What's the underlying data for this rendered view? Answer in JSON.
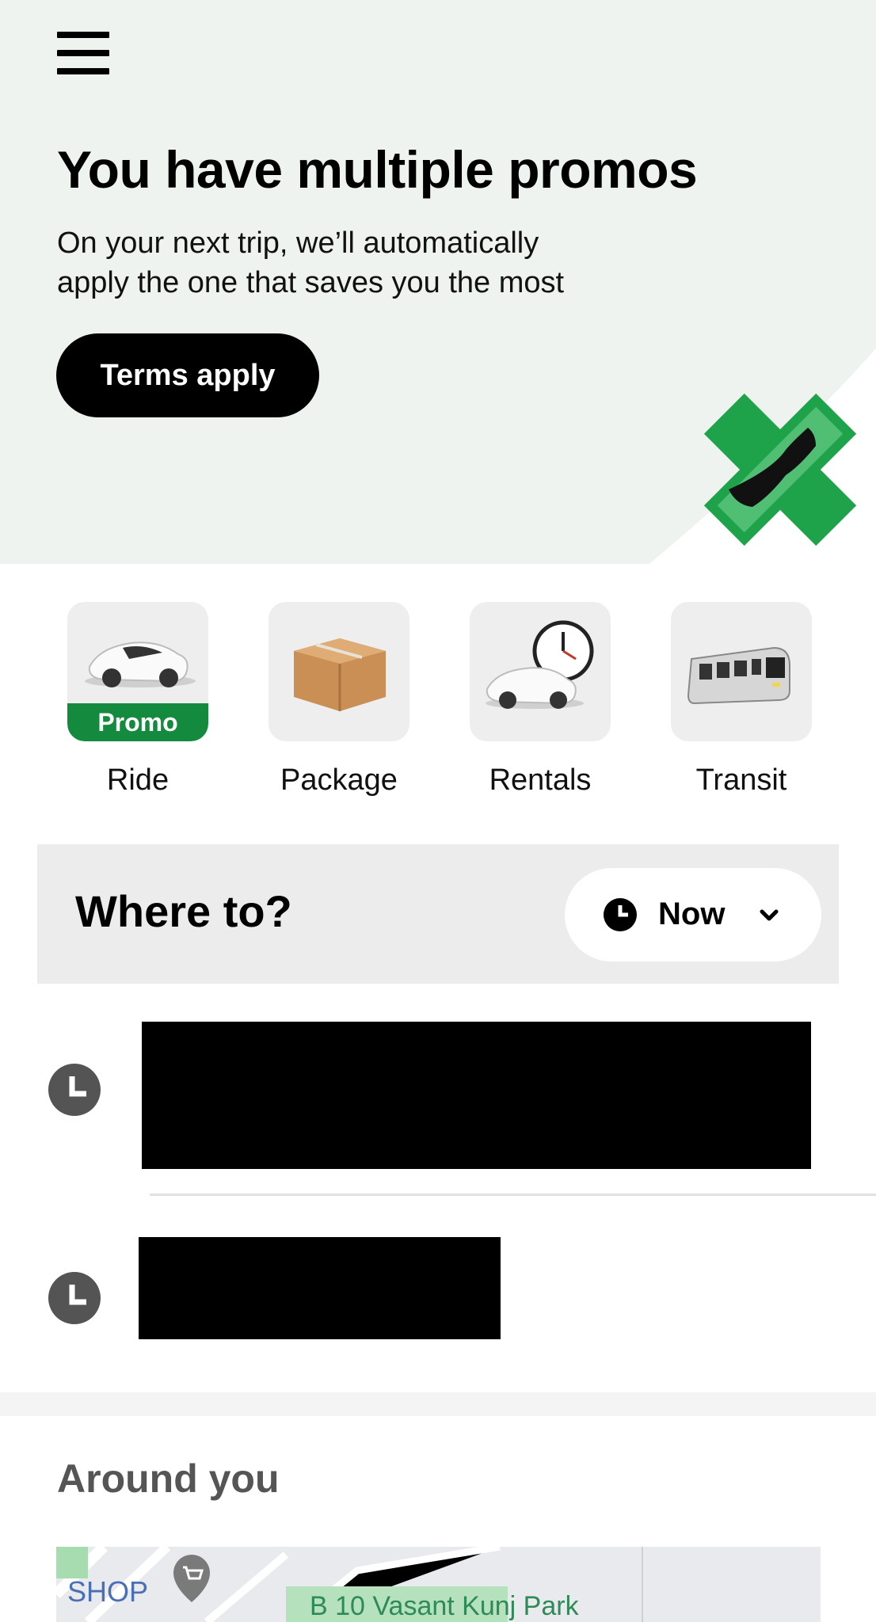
{
  "header": {
    "menu_icon": "hamburger-menu-icon"
  },
  "promo_banner": {
    "title": "You have multiple promos",
    "subtitle_line1": "On your next trip, we’ll automatically",
    "subtitle_line2": "apply the one that saves you the most",
    "button_label": "Terms apply",
    "accent_color": "#1fa34a"
  },
  "services": [
    {
      "label": "Ride",
      "badge": "Promo",
      "icon": "car-icon"
    },
    {
      "label": "Package",
      "icon": "box-icon"
    },
    {
      "label": "Rentals",
      "icon": "car-clock-icon"
    },
    {
      "label": "Transit",
      "icon": "train-icon"
    }
  ],
  "search": {
    "placeholder": "Where to?",
    "time_label": "Now",
    "time_icon": "clock-icon",
    "dropdown_icon": "chevron-down-icon"
  },
  "recent_places": [
    {
      "icon": "clock-icon",
      "redacted": true
    },
    {
      "icon": "clock-icon",
      "redacted": true
    }
  ],
  "around_you": {
    "title": "Around you",
    "map_labels": {
      "shop": "SHOP",
      "park": "B 10 Vasant Kunj Park"
    }
  },
  "colors": {
    "hero_background": "#eef3f0",
    "promo_green": "#138a3e",
    "tile_background": "#eeeeee"
  }
}
